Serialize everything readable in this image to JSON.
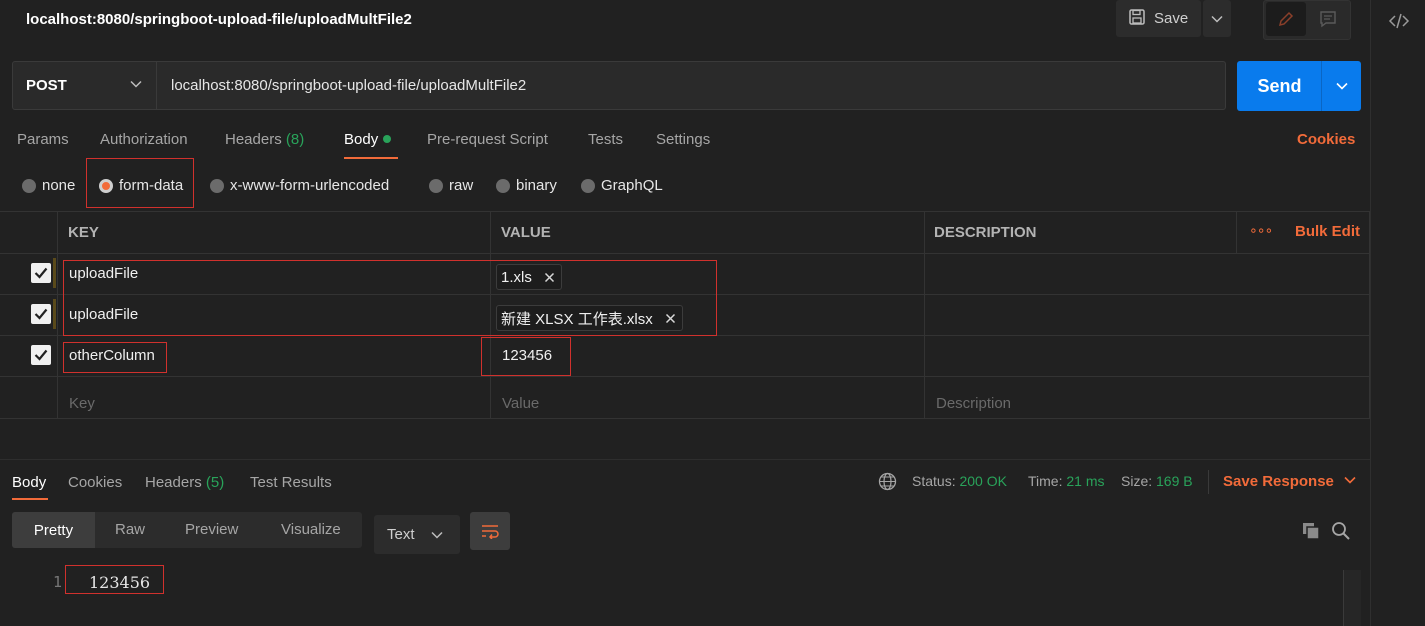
{
  "request": {
    "title": "localhost:8080/springboot-upload-file/uploadMultFile2",
    "method": "POST",
    "url": "localhost:8080/springboot-upload-file/uploadMultFile2",
    "save_label": "Save",
    "send_label": "Send"
  },
  "tabs": {
    "params": "Params",
    "authorization": "Authorization",
    "headers": "Headers",
    "headers_count": "(8)",
    "body": "Body",
    "pre_request": "Pre-request Script",
    "tests": "Tests",
    "settings": "Settings",
    "cookies": "Cookies"
  },
  "body_types": {
    "none": "none",
    "form_data": "form-data",
    "urlencoded": "x-www-form-urlencoded",
    "raw": "raw",
    "binary": "binary",
    "graphql": "GraphQL",
    "selected": "form-data"
  },
  "table": {
    "headers": {
      "key": "KEY",
      "value": "VALUE",
      "description": "DESCRIPTION",
      "more": "∘∘∘",
      "bulk_edit": "Bulk Edit"
    },
    "rows": [
      {
        "checked": true,
        "key": "uploadFile",
        "file": "1.xls",
        "description": ""
      },
      {
        "checked": true,
        "key": "uploadFile",
        "file": "新建 XLSX 工作表.xlsx",
        "description": ""
      },
      {
        "checked": true,
        "key": "otherColumn",
        "value": "123456",
        "description": ""
      }
    ],
    "placeholders": {
      "key": "Key",
      "value": "Value",
      "description": "Description"
    }
  },
  "response": {
    "tabs": {
      "body": "Body",
      "cookies": "Cookies",
      "headers": "Headers",
      "headers_count": "(5)",
      "test_results": "Test Results"
    },
    "status_label": "Status:",
    "status": "200 OK",
    "time_label": "Time:",
    "time": "21 ms",
    "size_label": "Size:",
    "size": "169 B",
    "save_response": "Save Response",
    "views": {
      "pretty": "Pretty",
      "raw": "Raw",
      "preview": "Preview",
      "visualize": "Visualize"
    },
    "format": "Text",
    "lines": [
      {
        "number": "1",
        "text": "123456"
      }
    ]
  },
  "colors": {
    "accent": "#f26b3a",
    "send": "#097bed",
    "success": "#29a35a",
    "annotation": "#d0312d"
  }
}
